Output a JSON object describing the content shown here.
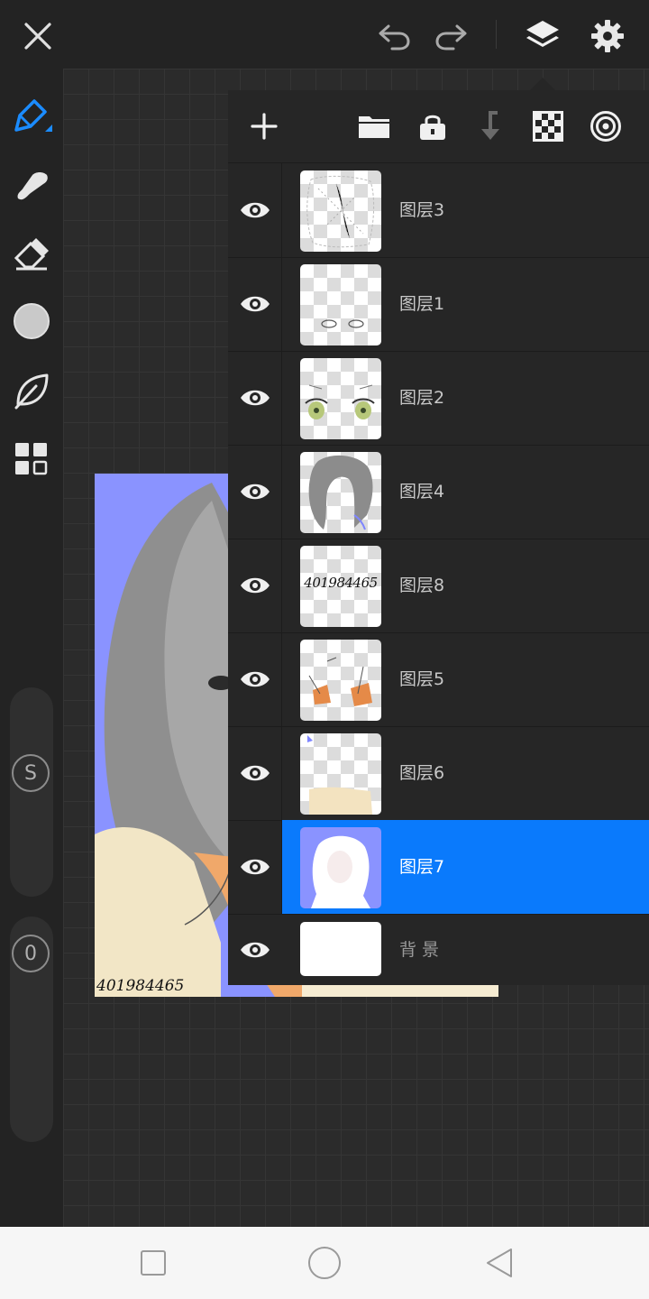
{
  "top_bar": {
    "close_icon": "close-icon",
    "undo_icon": "undo-icon",
    "redo_icon": "redo-icon",
    "layers_icon": "layers-icon",
    "settings_icon": "gear-icon"
  },
  "sidebar": {
    "tools": [
      "brush-icon",
      "smudge-icon",
      "eraser-icon",
      "color-circle-icon",
      "leaf-icon",
      "grid-icon"
    ],
    "size_slider_label": "S",
    "opacity_slider_label": "0"
  },
  "artwork": {
    "watermark": "401984465"
  },
  "layers_panel": {
    "toolbar_icons": [
      "add-icon",
      "folder-icon",
      "lock-icon",
      "merge-down-icon",
      "checker-icon",
      "spiral-icon"
    ],
    "layers": [
      {
        "name": "图层3",
        "visible": true,
        "selected": false
      },
      {
        "name": "图层1",
        "visible": true,
        "selected": false
      },
      {
        "name": "图层2",
        "visible": true,
        "selected": false
      },
      {
        "name": "图层4",
        "visible": true,
        "selected": false
      },
      {
        "name": "图层8",
        "visible": true,
        "selected": false,
        "thumb_text": "401984465"
      },
      {
        "name": "图层5",
        "visible": true,
        "selected": false
      },
      {
        "name": "图层6",
        "visible": true,
        "selected": false
      },
      {
        "name": "图层7",
        "visible": true,
        "selected": true
      },
      {
        "name": "背景",
        "visible": true,
        "selected": false
      }
    ]
  },
  "nav_bar": {
    "icons": [
      "recent-apps-icon",
      "home-icon",
      "back-icon"
    ]
  },
  "colors": {
    "accent": "#0a7afc",
    "canvas_background": "#8a93ff"
  }
}
